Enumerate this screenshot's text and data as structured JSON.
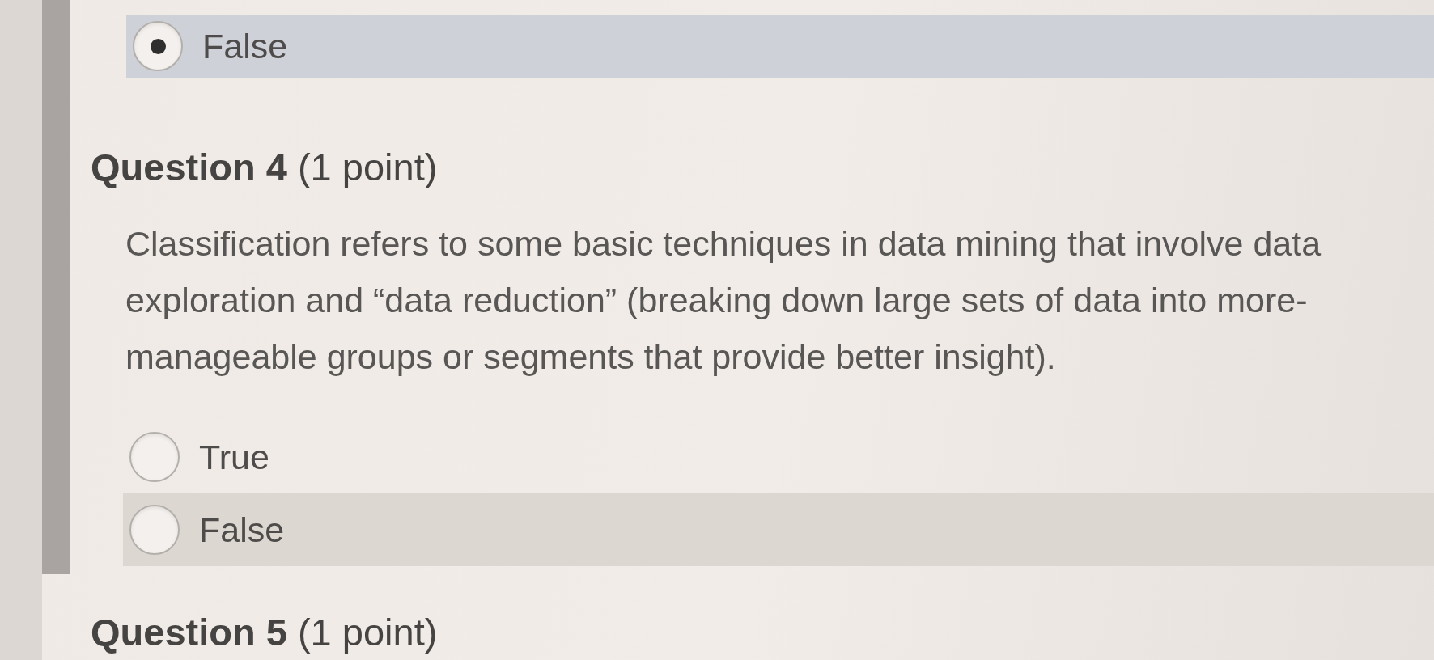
{
  "questions": [
    {
      "options": [
        {
          "label": "False",
          "selected": true,
          "highlighted": true
        }
      ]
    },
    {
      "title": "**Question 4** (1 point)",
      "text": "Classification refers to some basic techniques in data mining that involve data exploration and “data reduction” (breaking down large sets of data into more-manageable groups or segments that provide better insight).",
      "options": [
        {
          "label": "True",
          "selected": false,
          "highlighted": false
        },
        {
          "label": "False",
          "selected": false,
          "highlighted": true
        }
      ]
    },
    {
      "title": "**Question 5** (1 point)"
    }
  ]
}
